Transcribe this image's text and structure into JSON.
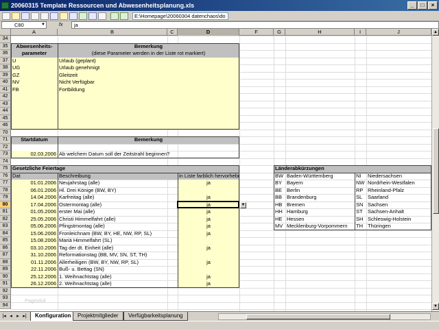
{
  "window": {
    "title": "20060315 Template Ressourcen und Abwesenheitsplanung.xls"
  },
  "toolbar": {
    "address": "E:\\Homepage\\20060304 datenchaos\\do"
  },
  "formula_bar": {
    "name_box": "C80",
    "fx": "fx",
    "value": "ja"
  },
  "columns": [
    "A",
    "B",
    "C",
    "D",
    "F",
    "G",
    "H",
    "I",
    "J"
  ],
  "active_column": "D",
  "rows": [
    "34",
    "35",
    "36",
    "37",
    "38",
    "39",
    "40",
    "41",
    "42",
    "43",
    "44",
    "45",
    "46",
    "70",
    "71",
    "72",
    "73",
    "74",
    "75",
    "76",
    "77",
    "78",
    "79",
    "80",
    "81",
    "82",
    "83",
    "84",
    "85",
    "86",
    "87",
    "88",
    "89",
    "90",
    "91",
    "92",
    "93",
    "94"
  ],
  "active_row": "80",
  "absence": {
    "header_col1": "Abwesenheits-parameter",
    "header_col2": "Bemerkung",
    "header_note": "(diese Parameter werden in der Liste rot markiert)",
    "items": [
      {
        "code": "U",
        "desc": "Urlaub (geplant)"
      },
      {
        "code": "UG",
        "desc": "Urlaub genehmigt"
      },
      {
        "code": "GZ",
        "desc": "Gleitzeit"
      },
      {
        "code": "NV",
        "desc": "Nicht Verfügbar"
      },
      {
        "code": "FB",
        "desc": "Fortbildung"
      }
    ]
  },
  "start": {
    "header_col1": "Startdatum",
    "header_col2": "Bemerkung",
    "date": "02.03.2006",
    "note": "Ab welchem Datum soll der Zeitstrahl beginnen?"
  },
  "holidays": {
    "title": "Gesetzliche Feiertage",
    "col_date": "Dat",
    "col_desc": "Beschreibung",
    "col_highlight": "in Liste farblich hervorheben?",
    "items": [
      {
        "date": "01.01.2006",
        "desc": "Neujahrstag (alle)",
        "flag": "ja"
      },
      {
        "date": "06.01.2006",
        "desc": "Hl. Drei Könige (BW, BY)",
        "flag": ""
      },
      {
        "date": "14.04.2006",
        "desc": "Karfreitag (alle)",
        "flag": "ja"
      },
      {
        "date": "17.04.2006",
        "desc": "Ostermontag (alle)",
        "flag": "ja"
      },
      {
        "date": "01.05.2006",
        "desc": "erster Mai (alle)",
        "flag": "ja"
      },
      {
        "date": "25.05.2006",
        "desc": "Christi Himmelfahrt (alle)",
        "flag": "ja"
      },
      {
        "date": "05.06.2006",
        "desc": "Pfingstmontag (alle)",
        "flag": "ja"
      },
      {
        "date": "15.06.2006",
        "desc": "Fronleichnam (BW, BY, HE, NW, RP, SL)",
        "flag": "ja"
      },
      {
        "date": "15.08.2006",
        "desc": "Mariä Himmelfahrt (SL)",
        "flag": ""
      },
      {
        "date": "03.10.2006",
        "desc": "Tag der dt. Einheit (alle)",
        "flag": "ja"
      },
      {
        "date": "31.10.2006",
        "desc": "Reformationstag (BB, MV, SN, ST, TH)",
        "flag": ""
      },
      {
        "date": "01.11.2006",
        "desc": "Allerheiligen (BW, BY, NW, RP, SL)",
        "flag": "ja"
      },
      {
        "date": "22.11.2006",
        "desc": "Buß- u. Bettag (SN)",
        "flag": ""
      },
      {
        "date": "25.12.2006",
        "desc": "1. Weihnachtstag (alle)",
        "flag": "ja"
      },
      {
        "date": "26.12.2006",
        "desc": "2. Weihnachtstag (alle)",
        "flag": "ja"
      }
    ]
  },
  "states": {
    "title": "Länderabkürzungen",
    "left": [
      {
        "code": "BW",
        "name": "Baden-Württemberg"
      },
      {
        "code": "BY",
        "name": "Bayern"
      },
      {
        "code": "BE",
        "name": "Berlin"
      },
      {
        "code": "BB",
        "name": "Brandenburg"
      },
      {
        "code": "HB",
        "name": "Bremen"
      },
      {
        "code": "HH",
        "name": "Hamburg"
      },
      {
        "code": "HE",
        "name": "Hessen"
      },
      {
        "code": "MV",
        "name": "Mecklenburg-Vorpommern"
      }
    ],
    "right": [
      {
        "code": "NI",
        "name": "Niedersachsen"
      },
      {
        "code": "NW",
        "name": "Nordrhein-Westfalen"
      },
      {
        "code": "RP",
        "name": "Rheinland-Pfalz"
      },
      {
        "code": "SL",
        "name": "Saarland"
      },
      {
        "code": "SN",
        "name": "Sachsen"
      },
      {
        "code": "ST",
        "name": "Sachsen-Anhalt"
      },
      {
        "code": "SH",
        "name": "Schleswig-Holstein"
      },
      {
        "code": "TH",
        "name": "Thüringen"
      }
    ]
  },
  "watermark": "Pagesfuli",
  "tabs": [
    "Konfiguration",
    "Projektmitglieder",
    "Verfügbarkeitsplanung"
  ],
  "active_tab": "Konfiguration",
  "colors": {
    "input_fill": "#ffffcc",
    "header_fill": "#c0c0c0",
    "titlebar": "#0a246a"
  },
  "icons": [
    "new-icon",
    "open-icon",
    "save-icon",
    "print-icon",
    "preview-icon",
    "copy-icon",
    "paste-icon",
    "undo-icon",
    "chart-icon",
    "sort-icon",
    "zoom-icon",
    "back-icon",
    "forward-icon",
    "refresh-icon",
    "home-icon",
    "search-icon",
    "web-icon"
  ]
}
